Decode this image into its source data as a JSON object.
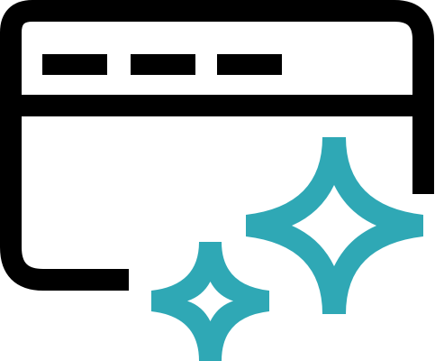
{
  "icon": {
    "semantic_name": "browser-window-sparkles-icon",
    "colors": {
      "outline": "#000000",
      "sparkle": "#2FA8B5",
      "background": "#FFFFFF"
    }
  }
}
